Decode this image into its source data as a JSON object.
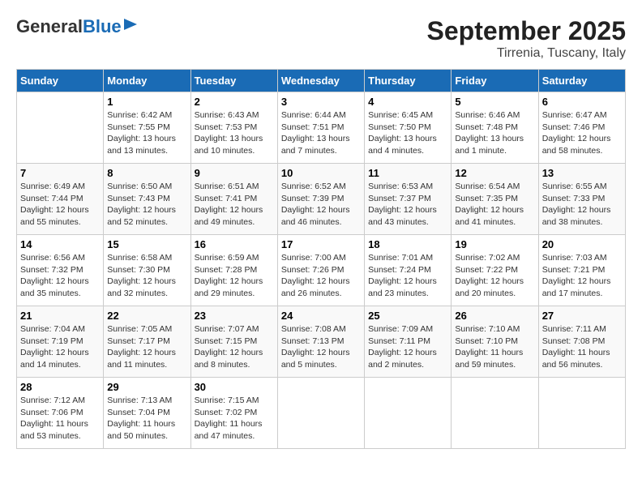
{
  "header": {
    "logo_general": "General",
    "logo_blue": "Blue",
    "month": "September 2025",
    "location": "Tirrenia, Tuscany, Italy"
  },
  "weekdays": [
    "Sunday",
    "Monday",
    "Tuesday",
    "Wednesday",
    "Thursday",
    "Friday",
    "Saturday"
  ],
  "weeks": [
    [
      {
        "day": "",
        "sunrise": "",
        "sunset": "",
        "daylight": ""
      },
      {
        "day": "1",
        "sunrise": "Sunrise: 6:42 AM",
        "sunset": "Sunset: 7:55 PM",
        "daylight": "Daylight: 13 hours and 13 minutes."
      },
      {
        "day": "2",
        "sunrise": "Sunrise: 6:43 AM",
        "sunset": "Sunset: 7:53 PM",
        "daylight": "Daylight: 13 hours and 10 minutes."
      },
      {
        "day": "3",
        "sunrise": "Sunrise: 6:44 AM",
        "sunset": "Sunset: 7:51 PM",
        "daylight": "Daylight: 13 hours and 7 minutes."
      },
      {
        "day": "4",
        "sunrise": "Sunrise: 6:45 AM",
        "sunset": "Sunset: 7:50 PM",
        "daylight": "Daylight: 13 hours and 4 minutes."
      },
      {
        "day": "5",
        "sunrise": "Sunrise: 6:46 AM",
        "sunset": "Sunset: 7:48 PM",
        "daylight": "Daylight: 13 hours and 1 minute."
      },
      {
        "day": "6",
        "sunrise": "Sunrise: 6:47 AM",
        "sunset": "Sunset: 7:46 PM",
        "daylight": "Daylight: 12 hours and 58 minutes."
      }
    ],
    [
      {
        "day": "7",
        "sunrise": "Sunrise: 6:49 AM",
        "sunset": "Sunset: 7:44 PM",
        "daylight": "Daylight: 12 hours and 55 minutes."
      },
      {
        "day": "8",
        "sunrise": "Sunrise: 6:50 AM",
        "sunset": "Sunset: 7:43 PM",
        "daylight": "Daylight: 12 hours and 52 minutes."
      },
      {
        "day": "9",
        "sunrise": "Sunrise: 6:51 AM",
        "sunset": "Sunset: 7:41 PM",
        "daylight": "Daylight: 12 hours and 49 minutes."
      },
      {
        "day": "10",
        "sunrise": "Sunrise: 6:52 AM",
        "sunset": "Sunset: 7:39 PM",
        "daylight": "Daylight: 12 hours and 46 minutes."
      },
      {
        "day": "11",
        "sunrise": "Sunrise: 6:53 AM",
        "sunset": "Sunset: 7:37 PM",
        "daylight": "Daylight: 12 hours and 43 minutes."
      },
      {
        "day": "12",
        "sunrise": "Sunrise: 6:54 AM",
        "sunset": "Sunset: 7:35 PM",
        "daylight": "Daylight: 12 hours and 41 minutes."
      },
      {
        "day": "13",
        "sunrise": "Sunrise: 6:55 AM",
        "sunset": "Sunset: 7:33 PM",
        "daylight": "Daylight: 12 hours and 38 minutes."
      }
    ],
    [
      {
        "day": "14",
        "sunrise": "Sunrise: 6:56 AM",
        "sunset": "Sunset: 7:32 PM",
        "daylight": "Daylight: 12 hours and 35 minutes."
      },
      {
        "day": "15",
        "sunrise": "Sunrise: 6:58 AM",
        "sunset": "Sunset: 7:30 PM",
        "daylight": "Daylight: 12 hours and 32 minutes."
      },
      {
        "day": "16",
        "sunrise": "Sunrise: 6:59 AM",
        "sunset": "Sunset: 7:28 PM",
        "daylight": "Daylight: 12 hours and 29 minutes."
      },
      {
        "day": "17",
        "sunrise": "Sunrise: 7:00 AM",
        "sunset": "Sunset: 7:26 PM",
        "daylight": "Daylight: 12 hours and 26 minutes."
      },
      {
        "day": "18",
        "sunrise": "Sunrise: 7:01 AM",
        "sunset": "Sunset: 7:24 PM",
        "daylight": "Daylight: 12 hours and 23 minutes."
      },
      {
        "day": "19",
        "sunrise": "Sunrise: 7:02 AM",
        "sunset": "Sunset: 7:22 PM",
        "daylight": "Daylight: 12 hours and 20 minutes."
      },
      {
        "day": "20",
        "sunrise": "Sunrise: 7:03 AM",
        "sunset": "Sunset: 7:21 PM",
        "daylight": "Daylight: 12 hours and 17 minutes."
      }
    ],
    [
      {
        "day": "21",
        "sunrise": "Sunrise: 7:04 AM",
        "sunset": "Sunset: 7:19 PM",
        "daylight": "Daylight: 12 hours and 14 minutes."
      },
      {
        "day": "22",
        "sunrise": "Sunrise: 7:05 AM",
        "sunset": "Sunset: 7:17 PM",
        "daylight": "Daylight: 12 hours and 11 minutes."
      },
      {
        "day": "23",
        "sunrise": "Sunrise: 7:07 AM",
        "sunset": "Sunset: 7:15 PM",
        "daylight": "Daylight: 12 hours and 8 minutes."
      },
      {
        "day": "24",
        "sunrise": "Sunrise: 7:08 AM",
        "sunset": "Sunset: 7:13 PM",
        "daylight": "Daylight: 12 hours and 5 minutes."
      },
      {
        "day": "25",
        "sunrise": "Sunrise: 7:09 AM",
        "sunset": "Sunset: 7:11 PM",
        "daylight": "Daylight: 12 hours and 2 minutes."
      },
      {
        "day": "26",
        "sunrise": "Sunrise: 7:10 AM",
        "sunset": "Sunset: 7:10 PM",
        "daylight": "Daylight: 11 hours and 59 minutes."
      },
      {
        "day": "27",
        "sunrise": "Sunrise: 7:11 AM",
        "sunset": "Sunset: 7:08 PM",
        "daylight": "Daylight: 11 hours and 56 minutes."
      }
    ],
    [
      {
        "day": "28",
        "sunrise": "Sunrise: 7:12 AM",
        "sunset": "Sunset: 7:06 PM",
        "daylight": "Daylight: 11 hours and 53 minutes."
      },
      {
        "day": "29",
        "sunrise": "Sunrise: 7:13 AM",
        "sunset": "Sunset: 7:04 PM",
        "daylight": "Daylight: 11 hours and 50 minutes."
      },
      {
        "day": "30",
        "sunrise": "Sunrise: 7:15 AM",
        "sunset": "Sunset: 7:02 PM",
        "daylight": "Daylight: 11 hours and 47 minutes."
      },
      {
        "day": "",
        "sunrise": "",
        "sunset": "",
        "daylight": ""
      },
      {
        "day": "",
        "sunrise": "",
        "sunset": "",
        "daylight": ""
      },
      {
        "day": "",
        "sunrise": "",
        "sunset": "",
        "daylight": ""
      },
      {
        "day": "",
        "sunrise": "",
        "sunset": "",
        "daylight": ""
      }
    ]
  ]
}
